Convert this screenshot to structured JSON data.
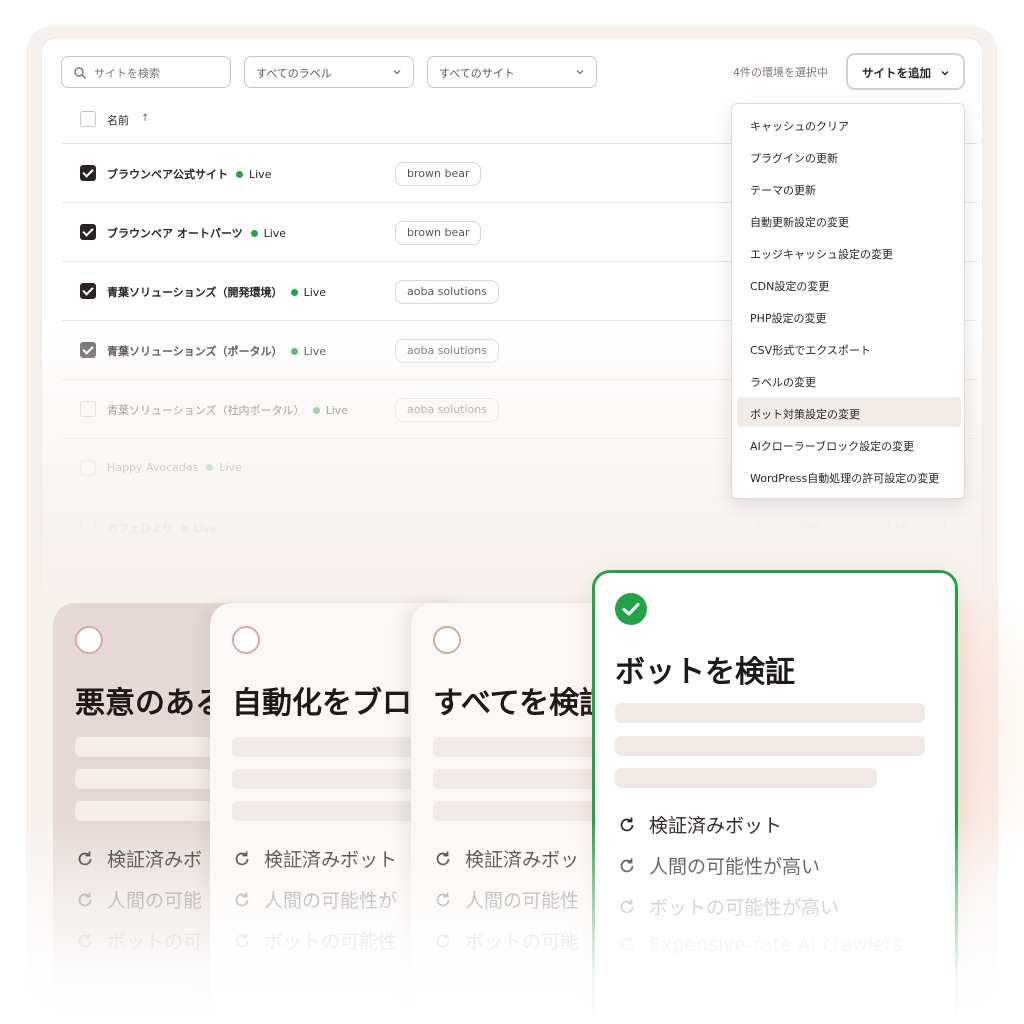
{
  "toolbar": {
    "search_placeholder": "サイトを検索",
    "label_filter": "すべてのラベル",
    "site_filter": "すべてのサイト",
    "selected_count": "4件の環境を選択中",
    "add_site": "サイトを追加"
  },
  "table": {
    "name_header": "名前",
    "sort_indicator": "↑",
    "rows": [
      {
        "name": "ブラウンベア公式サイト",
        "status": "Live",
        "label": "brown bear",
        "checked": true
      },
      {
        "name": "ブラウンベア オートパーツ",
        "status": "Live",
        "label": "brown bear",
        "checked": true
      },
      {
        "name": "青葉ソリューションズ（開発環境）",
        "status": "Live",
        "label": "aoba solutions",
        "checked": true
      },
      {
        "name": "青葉ソリューションズ（ポータル）",
        "status": "Live",
        "label": "aoba solutions",
        "checked": true
      },
      {
        "name": "青葉ソリューションズ（社内ポータル）",
        "status": "Live",
        "label": "aoba solutions",
        "checked": false
      },
      {
        "name": "Happy Avocados",
        "status": "Live",
        "label": "",
        "checked": false
      },
      {
        "name": "カフェひより",
        "status": "Live",
        "label": "",
        "checked": false,
        "visits": "6",
        "size": "2MB",
        "bandwidth": "21 kB"
      }
    ]
  },
  "menu": {
    "items": [
      "キャッシュのクリア",
      "プラグインの更新",
      "テーマの更新",
      "自動更新設定の変更",
      "エッジキャッシュ設定の変更",
      "CDN設定の変更",
      "PHP設定の変更",
      "CSV形式でエクスポート",
      "ラベルの変更",
      "ボット対策設定の変更",
      "AIクローラーブロック設定の変更",
      "WordPress自動処理の許可設定の変更"
    ],
    "highlighted_index": 9
  },
  "cards": [
    {
      "title": "悪意のある",
      "features": [
        "検証済みボ",
        "人間の可能",
        "ボットの可"
      ],
      "selected": false
    },
    {
      "title": "自動化をブロ",
      "features": [
        "検証済みボット",
        "人間の可能性が",
        "ボットの可能性"
      ],
      "selected": false
    },
    {
      "title": "すべてを検証",
      "features": [
        "検証済みボッ",
        "人間の可能性",
        "ボットの可能"
      ],
      "selected": false
    },
    {
      "title": "ボットを検証",
      "features": [
        "検証済みボット",
        "人間の可能性が高い",
        "ボットの可能性が高い",
        "Expensive-rate AI crawlers"
      ],
      "selected": true
    }
  ],
  "colors": {
    "live_dot": "#22a447",
    "selected_border": "#25a346",
    "accent_glow": "#ffaa8c"
  }
}
